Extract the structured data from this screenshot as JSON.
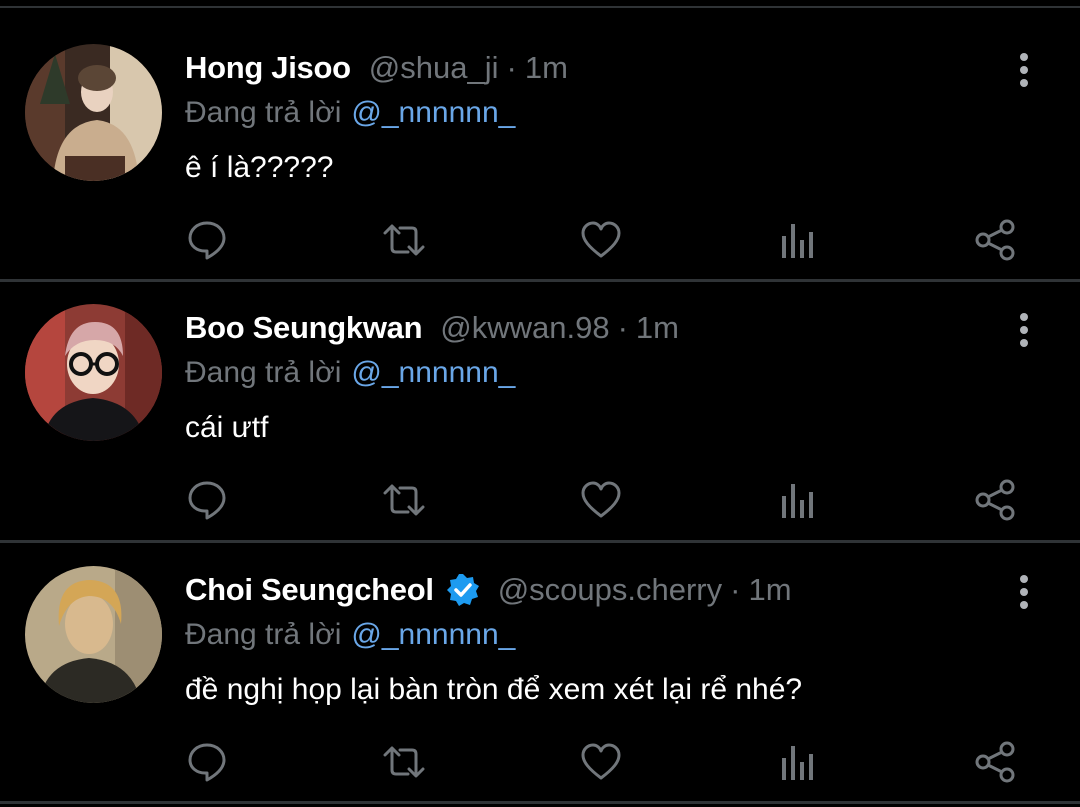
{
  "colors": {
    "background": "#000000",
    "divider": "#2f3336",
    "secondary_text": "#71767b",
    "mention": "#6aa7e8",
    "verified": "#1d9bf0",
    "icon": "#71767b"
  },
  "reply_prefix": "Đang trả lời",
  "tweets": [
    {
      "name": "Hong Jisoo",
      "verified": false,
      "handle": "@shua_ji",
      "separator": "·",
      "time": "1m",
      "reply_to": "@_nnnnnn_",
      "text": "ê í là?????"
    },
    {
      "name": "Boo Seungkwan",
      "verified": false,
      "handle": "@kwwan.98",
      "separator": "·",
      "time": "1m",
      "reply_to": "@_nnnnnn_",
      "text": "cái ưtf"
    },
    {
      "name": "Choi Seungcheol",
      "verified": true,
      "handle": "@scoups.cherry",
      "separator": "·",
      "time": "1m",
      "reply_to": "@_nnnnnn_",
      "text": "đề nghị họp lại bàn tròn để xem xét lại rể nhé?"
    }
  ],
  "icons": [
    "reply-icon",
    "retweet-icon",
    "like-icon",
    "views-icon",
    "share-icon",
    "more-icon",
    "verified-badge-icon"
  ]
}
